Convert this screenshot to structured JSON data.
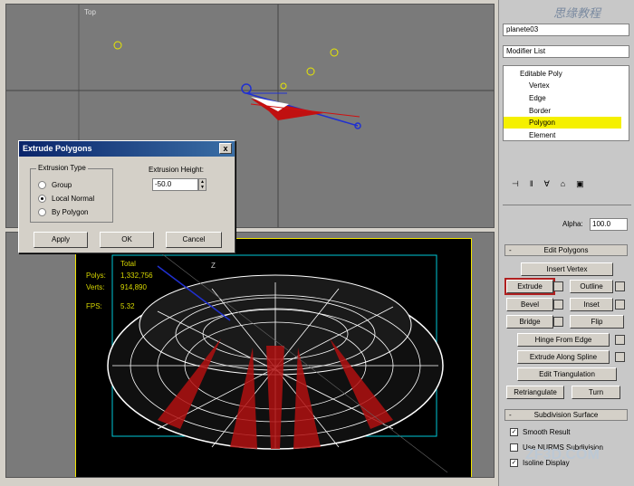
{
  "dialog": {
    "title": "Extrude Polygons",
    "close_label": "x",
    "extrusion_type_label": "Extrusion Type",
    "options": [
      "Group",
      "Local Normal",
      "By Polygon"
    ],
    "selected_option": "Local Normal",
    "height_label": "Extrusion Height:",
    "height_value": "-50.0",
    "apply_label": "Apply",
    "ok_label": "OK",
    "cancel_label": "Cancel"
  },
  "viewport_stats": {
    "total_label": "Total",
    "polys_label": "Polys:",
    "polys_value": "1,332,756",
    "verts_label": "Verts:",
    "verts_value": "914,890",
    "fps_label": "FPS:",
    "fps_value": "5.32",
    "axis_label": "Z"
  },
  "panel": {
    "logo": "思缘教程",
    "object_name": "planete03",
    "modifier_list": "Modifier List",
    "stack": [
      "Editable Poly",
      "Vertex",
      "Edge",
      "Border",
      "Polygon",
      "Element"
    ],
    "selected_stack_item": "Polygon",
    "alpha_label": "Alpha:",
    "alpha_value": "100.0",
    "edit_polygons_title": "Edit Polygons",
    "insert_vertex": "Insert Vertex",
    "extrude": "Extrude",
    "outline": "Outline",
    "bevel": "Bevel",
    "inset": "Inset",
    "bridge": "Bridge",
    "flip": "Flip",
    "hinge_from_edge": "Hinge From Edge",
    "extrude_along_spline": "Extrude Along Spline",
    "edit_triangulation": "Edit Triangulation",
    "retriangulate": "Retriangulate",
    "turn": "Turn",
    "subdivision_surface_title": "Subdivision Surface",
    "smooth_result": "Smooth Result",
    "use_nurms": "Use NURMS Subdivision",
    "isoline_display": "Isoline Display"
  },
  "watermark": "ZF3D.COM"
}
